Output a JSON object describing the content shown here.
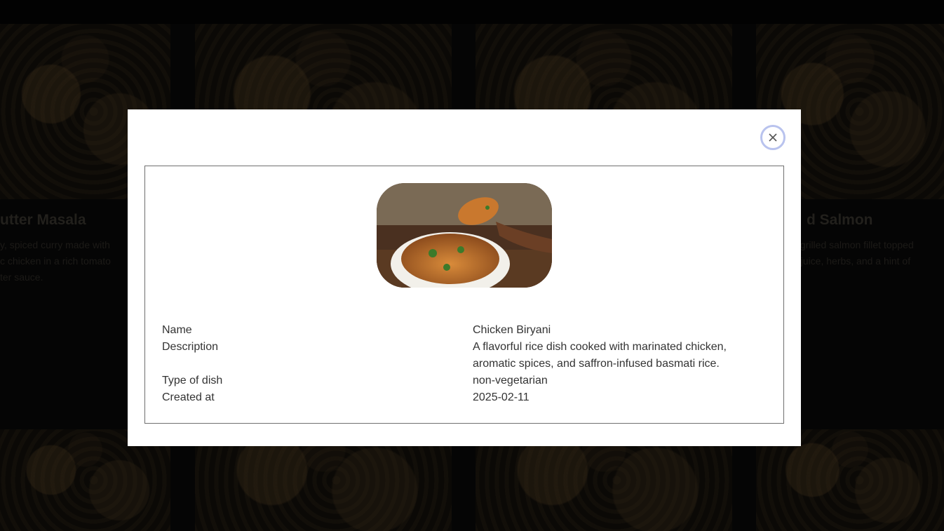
{
  "background": {
    "cards_top": [
      {
        "title": "utter Masala",
        "desc": [
          "y, spiced curry made with",
          "c chicken in a rich tomato",
          "ter sauce."
        ]
      },
      {
        "title": "d Salmon",
        "desc": [
          "y grilled salmon fillet topped",
          "n juice, herbs, and a hint of"
        ]
      }
    ]
  },
  "modal": {
    "close_label": "×",
    "fields": [
      {
        "label": "Name",
        "value": "Chicken Biryani"
      },
      {
        "label": "Description",
        "value": "A flavorful rice dish cooked with marinated chicken, aromatic spices, and saffron-infused basmati rice."
      },
      {
        "label": "Type of dish",
        "value": "non-vegetarian"
      },
      {
        "label": "Created at",
        "value": "2025-02-11"
      }
    ]
  }
}
